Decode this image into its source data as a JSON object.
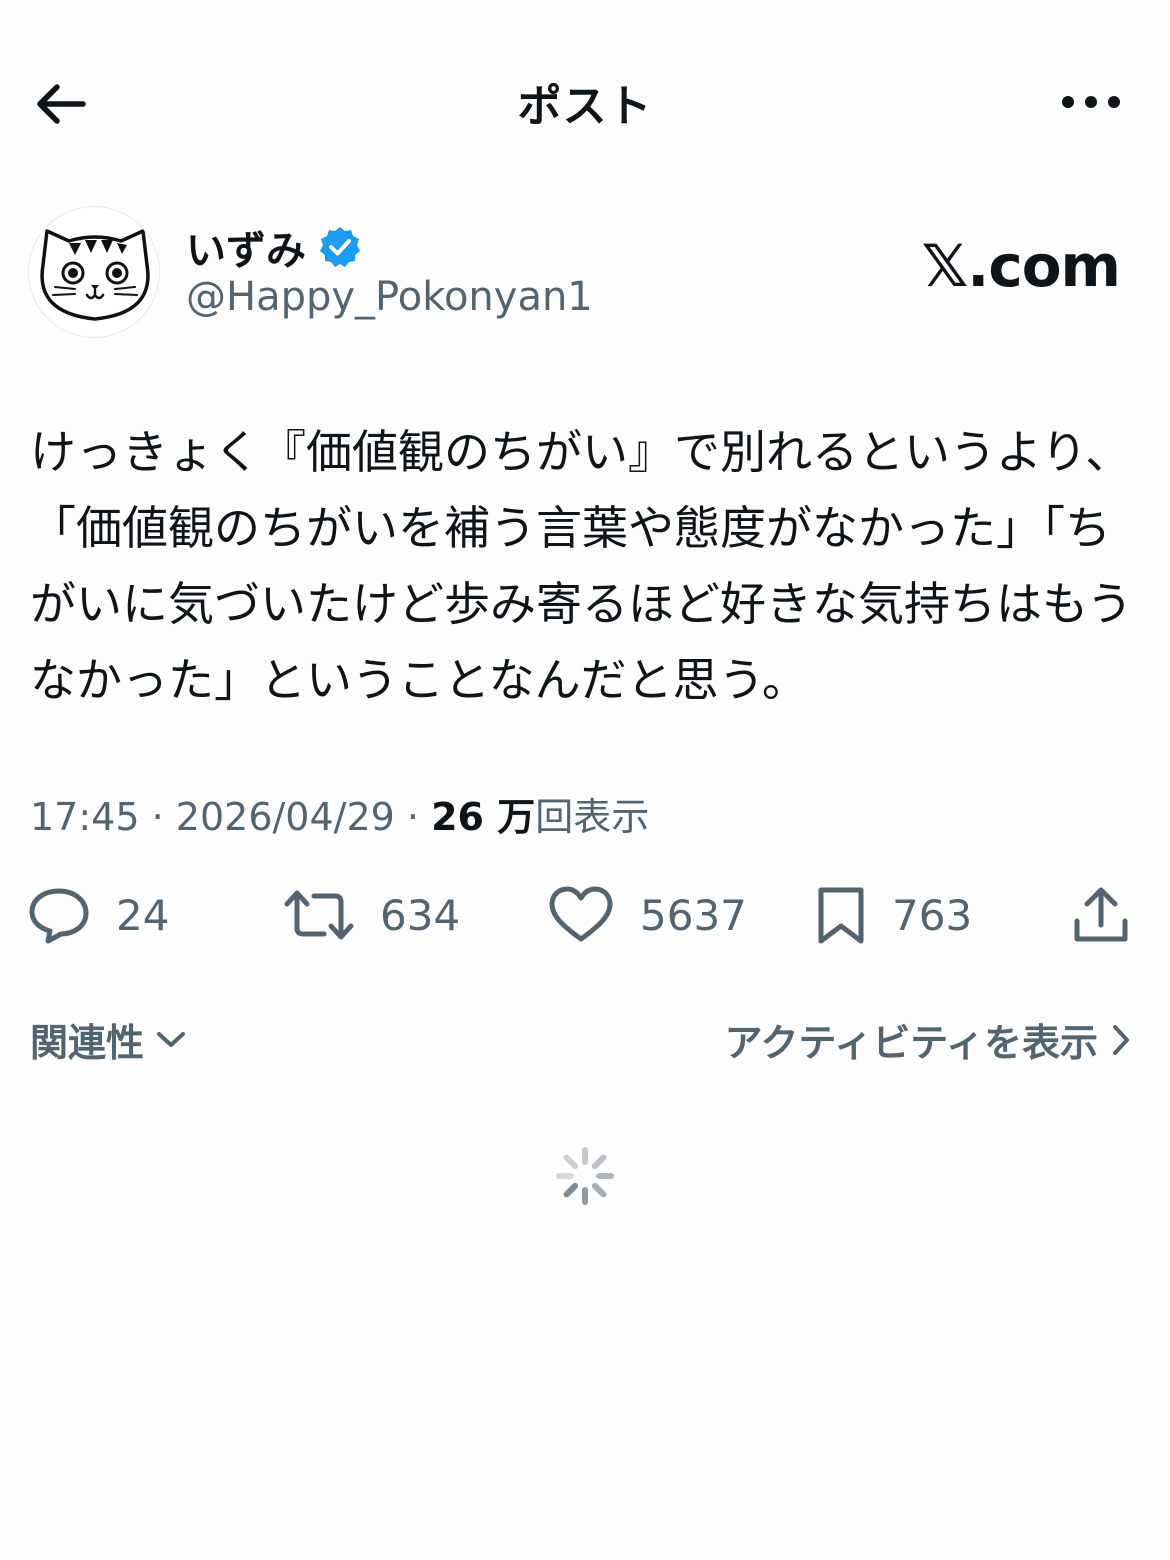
{
  "header": {
    "title": "ポスト"
  },
  "author": {
    "display_name": "いずみ",
    "handle": "@Happy_Pokonyan1",
    "verified": true
  },
  "watermark": "𝕏.com",
  "post": {
    "text": "けっきょく『価値観のちがい』で別れるというより、「価値観のちがいを補う言葉や態度がなかった」「ちがいに気づいたけど歩み寄るほど好きな気持ちはもうなかった」ということなんだと思う。"
  },
  "meta": {
    "time": "17:45",
    "separator": "·",
    "date": "2026/04/29",
    "views_count": "26 万",
    "views_label": "回表示"
  },
  "actions": {
    "replies": "24",
    "reposts": "634",
    "likes": "5637",
    "bookmarks": "763"
  },
  "footer": {
    "relevance_label": "関連性",
    "activity_label": "アクティビティを表示"
  },
  "colors": {
    "text_primary": "#0f1419",
    "text_secondary": "#536471",
    "verified_blue": "#1d9bf0",
    "background": "#fdfdfe"
  }
}
